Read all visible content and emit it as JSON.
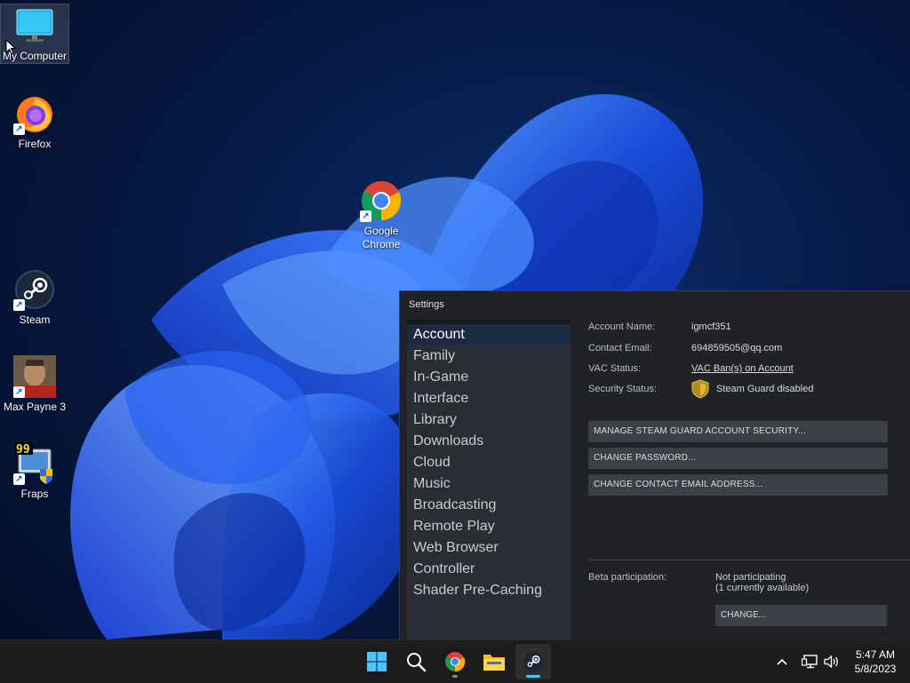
{
  "desktop": {
    "icons": [
      {
        "label": "My Computer"
      },
      {
        "label": "Firefox"
      },
      {
        "label": "Google Chrome"
      },
      {
        "label": "Steam"
      },
      {
        "label": "Max Payne 3"
      },
      {
        "label": "Fraps"
      }
    ]
  },
  "settings": {
    "title": "Settings",
    "nav": [
      "Account",
      "Family",
      "In-Game",
      "Interface",
      "Library",
      "Downloads",
      "Cloud",
      "Music",
      "Broadcasting",
      "Remote Play",
      "Web Browser",
      "Controller",
      "Shader Pre-Caching"
    ],
    "active_nav": "Account",
    "account": {
      "name_label": "Account Name:",
      "name_value": "igmcf351",
      "email_label": "Contact Email:",
      "email_value": "694859505@qq.com",
      "vac_label": "VAC Status:",
      "vac_value": "VAC Ban(s) on Account",
      "security_label": "Security Status:",
      "security_value": "Steam Guard disabled"
    },
    "buttons": {
      "manage_guard": "MANAGE STEAM GUARD ACCOUNT SECURITY...",
      "change_password": "CHANGE PASSWORD...",
      "change_email": "CHANGE CONTACT EMAIL ADDRESS..."
    },
    "beta": {
      "label": "Beta participation:",
      "status": "Not participating",
      "available": "(1 currently available)",
      "change": "CHANGE..."
    }
  },
  "taskbar": {
    "time": "5:47 AM",
    "date": "5/8/2023"
  },
  "colors": {
    "steam_bg": "#202227",
    "nav_active": "#1b2a40",
    "vac_red": "#c9342d",
    "taskbar": "#1c1c1c",
    "accent": "#4cc2ff"
  }
}
